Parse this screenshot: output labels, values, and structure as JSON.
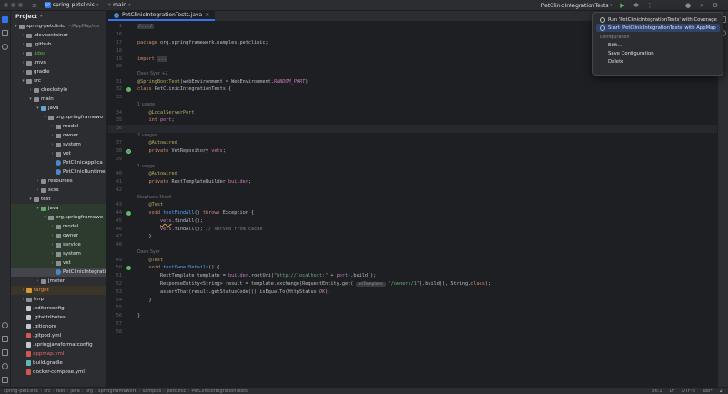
{
  "titlebar": {
    "project_badge": "SP",
    "project_name": "spring-petclinic",
    "branch": "main",
    "run_config": "PetClinicIntegrationTests"
  },
  "project_panel": {
    "title": "Project",
    "tree": [
      {
        "label": "spring-petclinic",
        "note": "~/AppMap/spr",
        "depth": 0,
        "open": true,
        "icon": "folder"
      },
      {
        "label": ".devcontainer",
        "depth": 1,
        "icon": "folder"
      },
      {
        "label": ".github",
        "depth": 1,
        "icon": "folder"
      },
      {
        "label": ".idea",
        "depth": 1,
        "icon": "folder",
        "color": "green"
      },
      {
        "label": ".mvn",
        "depth": 1,
        "icon": "folder"
      },
      {
        "label": "gradle",
        "depth": 1,
        "icon": "folder"
      },
      {
        "label": "src",
        "depth": 1,
        "icon": "folder",
        "open": true
      },
      {
        "label": "checkstyle",
        "depth": 2,
        "icon": "folder"
      },
      {
        "label": "main",
        "depth": 2,
        "icon": "folder",
        "open": true
      },
      {
        "label": "java",
        "depth": 3,
        "icon": "src",
        "open": true
      },
      {
        "label": "org.springframewo",
        "depth": 4,
        "icon": "pkg",
        "open": true
      },
      {
        "label": "model",
        "depth": 5,
        "icon": "pkg"
      },
      {
        "label": "owner",
        "depth": 5,
        "icon": "pkg"
      },
      {
        "label": "system",
        "depth": 5,
        "icon": "pkg"
      },
      {
        "label": "vet",
        "depth": 5,
        "icon": "pkg"
      },
      {
        "label": "PetClinicApplica",
        "depth": 5,
        "icon": "class",
        "leaf": true
      },
      {
        "label": "PetClinicRuntime",
        "depth": 5,
        "icon": "class",
        "leaf": true
      },
      {
        "label": "resources",
        "depth": 3,
        "icon": "folder"
      },
      {
        "label": "scss",
        "depth": 3,
        "icon": "folder"
      },
      {
        "label": "test",
        "depth": 2,
        "icon": "folder",
        "open": true
      },
      {
        "label": "java",
        "depth": 3,
        "icon": "test",
        "open": true,
        "bg": "green"
      },
      {
        "label": "org.springframewo",
        "depth": 4,
        "icon": "pkg",
        "open": true,
        "bg": "green"
      },
      {
        "label": "model",
        "depth": 5,
        "icon": "pkg",
        "bg": "green"
      },
      {
        "label": "owner",
        "depth": 5,
        "icon": "pkg",
        "bg": "green"
      },
      {
        "label": "service",
        "depth": 5,
        "icon": "pkg",
        "bg": "green"
      },
      {
        "label": "system",
        "depth": 5,
        "icon": "pkg",
        "bg": "green"
      },
      {
        "label": "vet",
        "depth": 5,
        "icon": "pkg",
        "bg": "green"
      },
      {
        "label": "PetClinicIntegratio",
        "depth": 5,
        "icon": "class",
        "leaf": true,
        "selected": true
      },
      {
        "label": "jmeter",
        "depth": 3,
        "icon": "folder"
      },
      {
        "label": "target",
        "depth": 1,
        "icon": "target",
        "color": "orange",
        "bg": "yellow"
      },
      {
        "label": "tmp",
        "depth": 1,
        "icon": "folder"
      },
      {
        "label": ".editorconfig",
        "depth": 1,
        "icon": "file",
        "leaf": true
      },
      {
        "label": ".gitattributes",
        "depth": 1,
        "icon": "file",
        "leaf": true
      },
      {
        "label": ".gitignore",
        "depth": 1,
        "icon": "file",
        "leaf": true
      },
      {
        "label": ".gitpod.yml",
        "depth": 1,
        "icon": "yml",
        "leaf": true
      },
      {
        "label": ".springjavaformatconfig",
        "depth": 1,
        "icon": "file",
        "leaf": true
      },
      {
        "label": "appmap.yml",
        "depth": 1,
        "icon": "yml",
        "leaf": true,
        "color": "red"
      },
      {
        "label": "build.gradle",
        "depth": 1,
        "icon": "gradle",
        "leaf": true
      },
      {
        "label": "docker-compose.yml",
        "depth": 1,
        "icon": "yml",
        "leaf": true
      }
    ]
  },
  "editor": {
    "tab_label": "PetClinicIntegrationTests.java",
    "lines": [
      {
        "n": "1",
        "html": "<span class=\"fold\">/.../</span>"
      },
      {
        "n": "16",
        "html": ""
      },
      {
        "n": "17",
        "html": "<span class=\"kw\">package</span> org.springframework.samples.petclinic;"
      },
      {
        "n": "18",
        "html": ""
      },
      {
        "n": "19",
        "html": "<span class=\"kw\">import</span> <span class=\"fold\">...</span>"
      },
      {
        "n": "30",
        "html": ""
      },
      {
        "hint": "Dave Syer +2"
      },
      {
        "n": "31",
        "html": "<span class=\"ann\">@SpringBootTest</span>(webEnvironment = WebEnvironment.<span class=\"const\">RANDOM_PORT</span>)"
      },
      {
        "n": "32",
        "gut": "run",
        "html": "<span class=\"kw\">class</span> PetClinicIntegrationTests {"
      },
      {
        "n": "33",
        "html": ""
      },
      {
        "hint": "1 usage"
      },
      {
        "n": "34",
        "html": "    <span class=\"ann\">@LocalServerPort</span>"
      },
      {
        "n": "35",
        "html": "    <span class=\"kw\">int</span> <span class=\"fld\">port</span>;"
      },
      {
        "n": "36",
        "current": true,
        "html": ""
      },
      {
        "hint": "2 usages"
      },
      {
        "n": "37",
        "html": "    <span class=\"ann\">@Autowired</span>"
      },
      {
        "n": "38",
        "gut": "bean",
        "html": "    <span class=\"kw\">private</span> VetRepository <span class=\"fld\">vets</span>;"
      },
      {
        "n": "39",
        "html": ""
      },
      {
        "hint": "1 usage"
      },
      {
        "n": "40",
        "html": "    <span class=\"ann\">@Autowired</span>"
      },
      {
        "n": "41",
        "html": "    <span class=\"kw\">private</span> RestTemplateBuilder <span class=\"fld\">builder</span>;"
      },
      {
        "n": "42",
        "html": ""
      },
      {
        "hint": "Stephane Nicoll"
      },
      {
        "n": "43",
        "html": "    <span class=\"ann\">@Test</span>"
      },
      {
        "n": "44",
        "gut": "run",
        "html": "    <span class=\"kw\">void</span> <span class=\"fn\">testFindAll</span>() <span class=\"kw\">throws</span> Exception {"
      },
      {
        "n": "45",
        "html": "        <span class=\"fld warn-ul\">vets</span>.findAll();"
      },
      {
        "n": "46",
        "html": "        <span class=\"fld\">vets</span>.findAll(); <span class=\"cmt\">// served from cache</span>"
      },
      {
        "n": "47",
        "html": "    }"
      },
      {
        "n": "48",
        "html": ""
      },
      {
        "hint": "Dave Syer"
      },
      {
        "n": "49",
        "html": "    <span class=\"ann\">@Test</span>"
      },
      {
        "n": "50",
        "gut": "run",
        "html": "    <span class=\"kw\">void</span> <span class=\"fn\">testOwnerDetails</span>() {"
      },
      {
        "n": "51",
        "html": "        RestTemplate template = <span class=\"fld\">builder</span>.rootUri(<span class=\"str\">\"http://localhost:\"</span> + <span class=\"fld\">port</span>).build();"
      },
      {
        "n": "52",
        "html": "        ResponseEntity&lt;String&gt; result = template.exchange(RequestEntity.get( <span class=\"inlay\">uriTemplate:</span> <span class=\"str\">\"/owners/1\"</span>).build(), String.<span class=\"kw\">class</span>);"
      },
      {
        "n": "53",
        "html": "        assertThat(result.getStatusCode()).isEqualTo(HttpStatus.<span class=\"const\">OK</span>);"
      },
      {
        "n": "54",
        "html": "    }"
      },
      {
        "n": "55",
        "html": ""
      },
      {
        "n": "56",
        "html": "}"
      },
      {
        "n": "57",
        "html": ""
      },
      {
        "n": "58",
        "html": ""
      }
    ]
  },
  "popup": {
    "item_coverage": "Run 'PetClinicIntegrationTests' with Coverage",
    "item_appmap": "Start 'PetClinicIntegrationTests' with AppMap",
    "section_label": "Configuration",
    "item_edit": "Edit...",
    "item_save": "Save Configuration",
    "item_delete": "Delete"
  },
  "statusbar": {
    "crumbs": [
      "spring-petclinic",
      "src",
      "test",
      "java",
      "org",
      "springframework",
      "samples",
      "petclinic",
      "PetClinicIntegrationTests"
    ],
    "position": "36:1",
    "line_sep": "LF",
    "encoding": "UTF-8",
    "indent": "Tab*"
  }
}
